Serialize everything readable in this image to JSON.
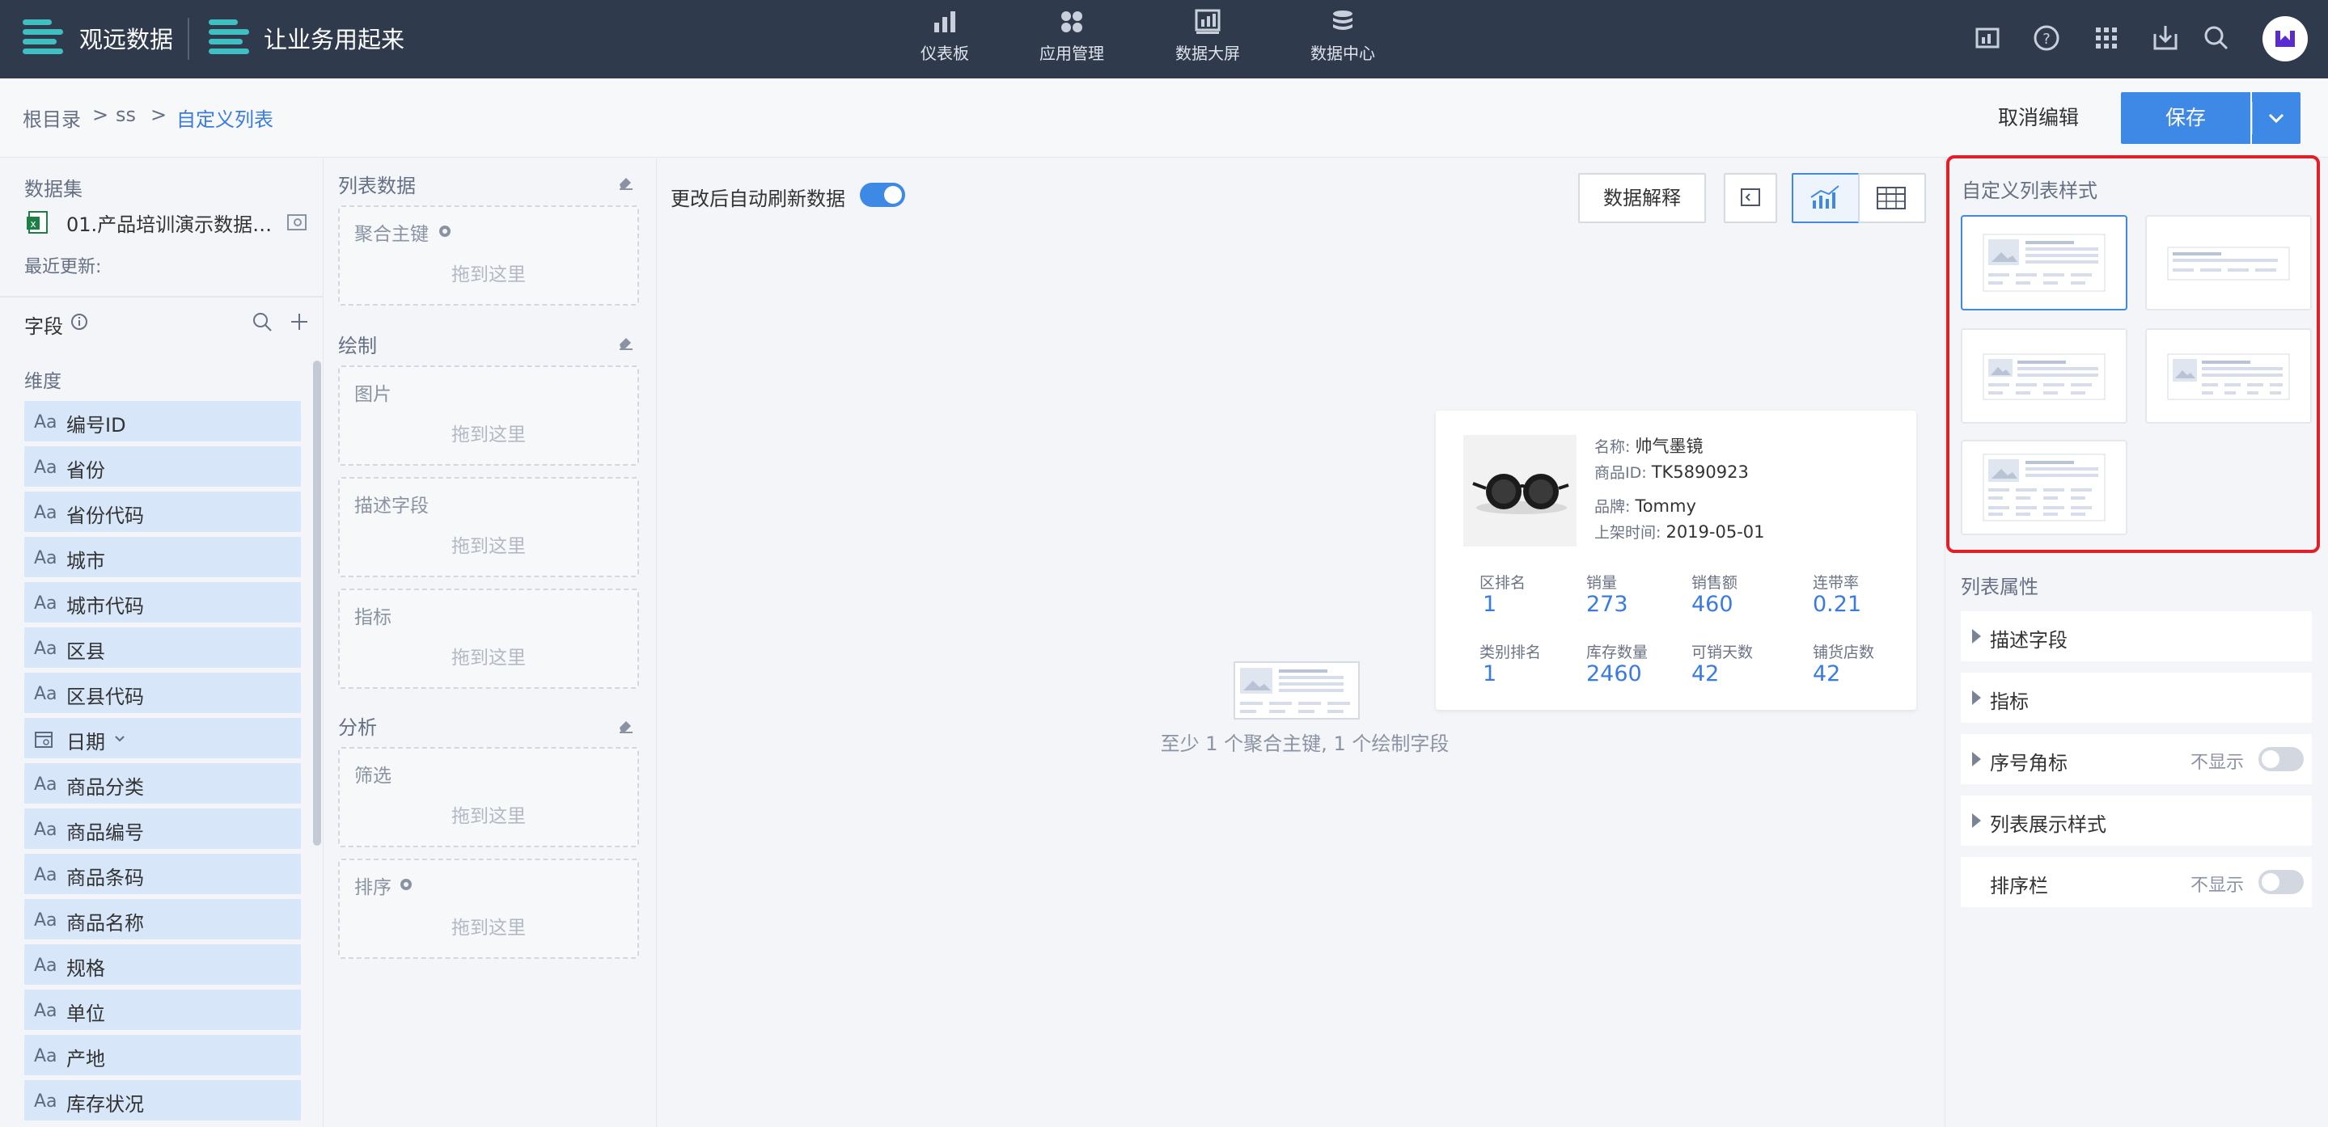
{
  "topbar": {
    "brand1": "观远数据",
    "brand2": "让业务用起来",
    "nav": [
      {
        "label": "仪表板",
        "icon": "bar-chart-icon"
      },
      {
        "label": "应用管理",
        "icon": "apps-icon"
      },
      {
        "label": "数据大屏",
        "icon": "screen-icon"
      },
      {
        "label": "数据中心",
        "icon": "database-icon"
      }
    ],
    "right_icons": [
      "report-icon",
      "help-icon",
      "grid-menu-icon",
      "download-icon",
      "search-icon"
    ]
  },
  "breadcrumb": {
    "items": [
      "根目录",
      "ss",
      "自定义列表"
    ],
    "sep": ">"
  },
  "actions": {
    "cancel": "取消编辑",
    "save": "保存"
  },
  "dataset": {
    "title": "数据集",
    "name": "01.产品培训演示数据…",
    "updated_label": "最近更新:"
  },
  "fields": {
    "title": "字段",
    "dimension_title": "维度",
    "items": [
      {
        "type": "Aa",
        "name": "编号ID"
      },
      {
        "type": "Aa",
        "name": "省份"
      },
      {
        "type": "Aa",
        "name": "省份代码"
      },
      {
        "type": "Aa",
        "name": "城市"
      },
      {
        "type": "Aa",
        "name": "城市代码"
      },
      {
        "type": "Aa",
        "name": "区县"
      },
      {
        "type": "Aa",
        "name": "区县代码"
      },
      {
        "type": "date",
        "name": "日期"
      },
      {
        "type": "Aa",
        "name": "商品分类"
      },
      {
        "type": "Aa",
        "name": "商品编号"
      },
      {
        "type": "Aa",
        "name": "商品条码"
      },
      {
        "type": "Aa",
        "name": "商品名称"
      },
      {
        "type": "Aa",
        "name": "规格"
      },
      {
        "type": "Aa",
        "name": "单位"
      },
      {
        "type": "Aa",
        "name": "产地"
      },
      {
        "type": "Aa",
        "name": "库存状况"
      }
    ]
  },
  "config": {
    "list_data_title": "列表数据",
    "draw_title": "绘制",
    "analysis_title": "分析",
    "drop_hint": "拖到这里",
    "slots": {
      "agg_key": "聚合主键",
      "image": "图片",
      "desc": "描述字段",
      "metric": "指标",
      "filter": "筛选",
      "sort": "排序"
    }
  },
  "canvas": {
    "auto_refresh_label": "更改后自动刷新数据",
    "data_explain_btn": "数据解释",
    "empty_hint": "至少 1 个聚合主键, 1 个绘制字段"
  },
  "preview_card": {
    "name_label": "名称:",
    "name_value": "帅气墨镜",
    "id_label": "商品ID:",
    "id_value": "TK5890923",
    "brand_label": "品牌:",
    "brand_value": "Tommy",
    "date_label": "上架时间:",
    "date_value": "2019-05-01",
    "metrics": [
      {
        "label": "区排名",
        "value": "1"
      },
      {
        "label": "销量",
        "value": "273"
      },
      {
        "label": "销售额",
        "value": "460"
      },
      {
        "label": "连带率",
        "value": "0.21"
      },
      {
        "label": "类别排名",
        "value": "1"
      },
      {
        "label": "库存数量",
        "value": "2460"
      },
      {
        "label": "可销天数",
        "value": "42"
      },
      {
        "label": "铺货店数",
        "value": "42"
      }
    ]
  },
  "right_panel": {
    "style_title": "自定义列表样式",
    "props_title": "列表属性",
    "props": [
      {
        "label": "描述字段",
        "value": ""
      },
      {
        "label": "指标",
        "value": ""
      },
      {
        "label": "序号角标",
        "value": "不显示"
      },
      {
        "label": "列表展示样式",
        "value": ""
      },
      {
        "label": "排序栏",
        "value": "不显示"
      }
    ]
  },
  "colors": {
    "accent": "#3e89e6",
    "topbar": "#2f3b4d",
    "highlight": "#e21f26",
    "field_bg": "#d7e6f8"
  }
}
